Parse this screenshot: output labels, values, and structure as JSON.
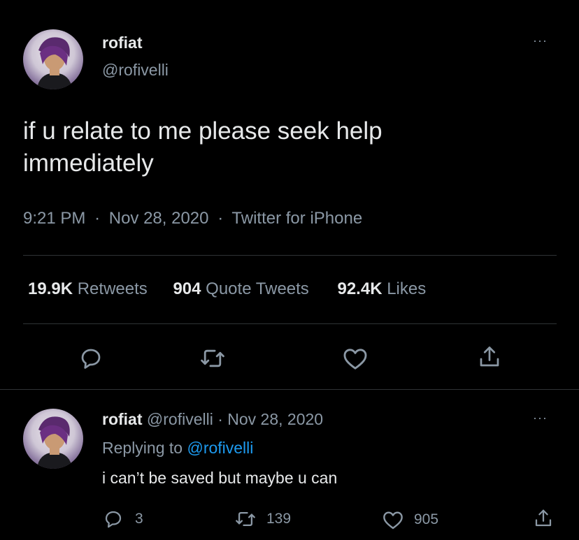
{
  "main_tweet": {
    "display_name": "rofiat",
    "handle": "@rofivelli",
    "text_line1": "if u relate to me please seek help",
    "text_line2": "immediately",
    "time": "9:21 PM",
    "date": "Nov 28, 2020",
    "source": "Twitter for iPhone",
    "sep": "·",
    "stats": {
      "retweets_count": "19.9K",
      "retweets_label": "Retweets",
      "quotes_count": "904",
      "quotes_label": "Quote Tweets",
      "likes_count": "92.4K",
      "likes_label": "Likes"
    },
    "more_label": "···",
    "icons": [
      "reply-icon",
      "retweet-icon",
      "like-icon",
      "share-icon"
    ]
  },
  "reply_tweet": {
    "display_name": "rofiat",
    "handle": "@rofivelli",
    "date": "Nov 28, 2020",
    "sep": "·",
    "replying_prefix": "Replying to",
    "replying_handle": "@rofivelli",
    "text": "i can’t be saved but maybe u can",
    "reply_count": "3",
    "retweet_count": "139",
    "like_count": "905",
    "more_label": "···"
  },
  "colors": {
    "background": "#000000",
    "text": "#e7e9ea",
    "muted": "#8b98a5",
    "link": "#1d9bf0",
    "divider": "#2f3336"
  }
}
